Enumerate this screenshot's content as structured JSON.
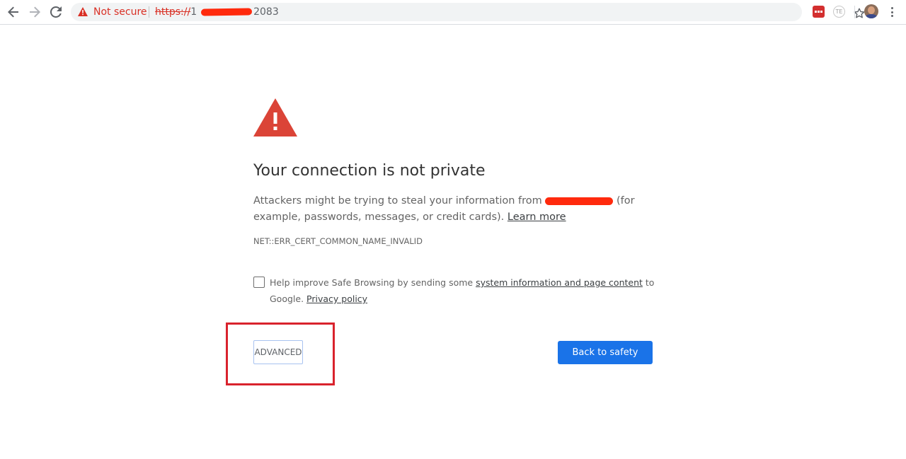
{
  "toolbar": {
    "icons": {
      "back": "arrow-left-icon",
      "forward": "arrow-right-icon",
      "reload": "reload-icon",
      "security": "warning-triangle-icon",
      "bookmark": "star-icon",
      "extension1": "extension-red-icon",
      "extension2": "extension-te-icon",
      "menu": "more-vert-icon"
    },
    "security_label": "Not secure",
    "url_scheme": "https://",
    "url_prefix": "1",
    "url_suffix": "2083",
    "extension_te_text": "TE"
  },
  "page": {
    "heading": "Your connection is not private",
    "explain_before": "Attackers might be trying to steal your information from ",
    "explain_after": " (for example, passwords, messages, or credit cards). ",
    "learn_more": "Learn more",
    "error_code": "NET::ERR_CERT_COMMON_NAME_INVALID",
    "safe_browsing_before": "Help improve Safe Browsing by sending some ",
    "safe_browsing_link": "system information and page content",
    "safe_browsing_middle": " to Google. ",
    "privacy_policy": "Privacy policy",
    "advanced_label": "ADVANCED",
    "back_label": "Back to safety"
  },
  "colors": {
    "danger": "#db4437",
    "primary_button": "#1a73e8",
    "highlight": "#d9232d",
    "not_secure": "#d93025"
  }
}
